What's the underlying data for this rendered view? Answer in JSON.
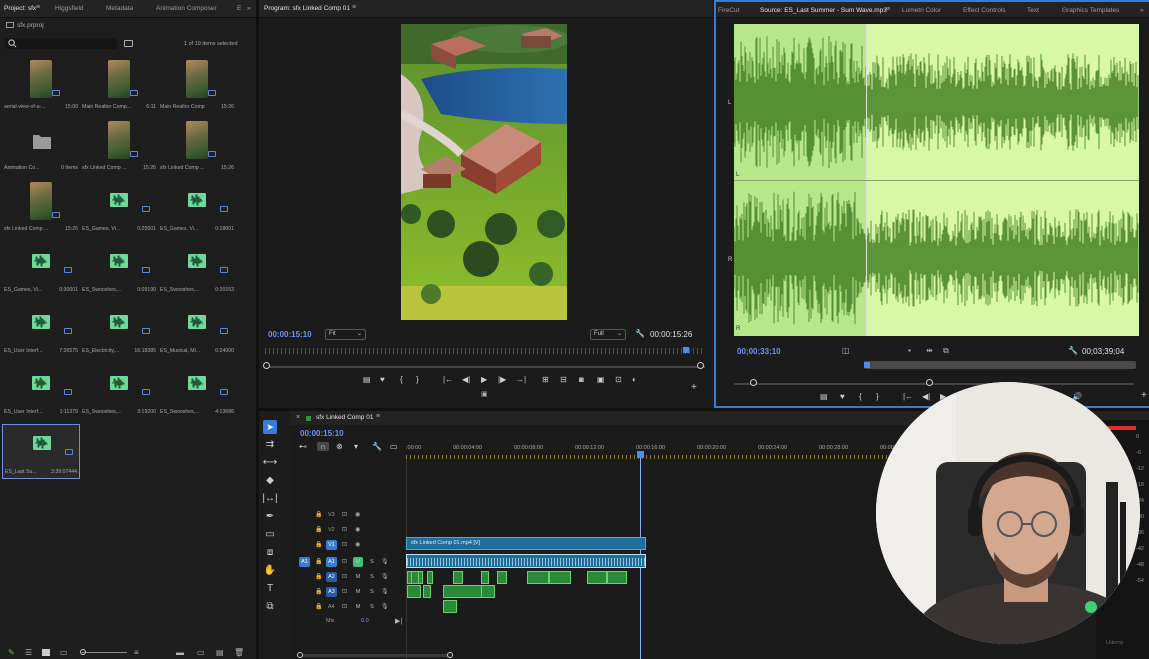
{
  "project_panel": {
    "tabs": [
      "Project: sfx",
      "Higgsfield",
      "Metadata",
      "Animation Composer",
      "E"
    ],
    "bin_name": "sfx.prproj",
    "selection_status": "1 of 19 items selected",
    "items": [
      {
        "name": "aerial-view-of-a-...",
        "duration": "15:00",
        "kind": "video"
      },
      {
        "name": "Main Realtor Comp...",
        "duration": "6:11",
        "kind": "video"
      },
      {
        "name": "Main Realtor Comp",
        "duration": "15:26",
        "kind": "video"
      },
      {
        "name": "Animation Co...",
        "duration": "0 Items",
        "kind": "folder"
      },
      {
        "name": "sfx Linked Comp ...",
        "duration": "15:26",
        "kind": "video"
      },
      {
        "name": "sfx Linked Comp ...",
        "duration": "15:26",
        "kind": "video"
      },
      {
        "name": "sfx Linked Comp ...",
        "duration": "15:26",
        "kind": "video"
      },
      {
        "name": "ES_Games, Vi...",
        "duration": "0:25501",
        "kind": "audio"
      },
      {
        "name": "ES_Games, Vi...",
        "duration": "0:18001",
        "kind": "audio"
      },
      {
        "name": "ES_Games, Vi...",
        "duration": "0:30001",
        "kind": "audio"
      },
      {
        "name": "ES_Swooshes,...",
        "duration": "0:09190",
        "kind": "audio"
      },
      {
        "name": "ES_Swooshes,...",
        "duration": "0:20153",
        "kind": "audio"
      },
      {
        "name": "ES_User Interf...",
        "duration": "7:36575",
        "kind": "audio"
      },
      {
        "name": "ES_Electricity,...",
        "duration": "16:18385",
        "kind": "audio"
      },
      {
        "name": "ES_Musical, Mi...",
        "duration": "0:24000",
        "kind": "audio"
      },
      {
        "name": "ES_User Interf...",
        "duration": "1:11379",
        "kind": "audio"
      },
      {
        "name": "ES_Swooshes,...",
        "duration": "3:19200",
        "kind": "audio"
      },
      {
        "name": "ES_Swooshes,...",
        "duration": "4:13686",
        "kind": "audio"
      },
      {
        "name": "ES_Last Su...",
        "duration": "3:39:07444",
        "kind": "audio",
        "selected": true
      }
    ]
  },
  "program_monitor": {
    "title": "Program: sfx Linked Comp 01",
    "timecode": "00:00:15:10",
    "fit": "Fit",
    "quality": "Full",
    "duration": "00:00:15:26"
  },
  "source_monitor": {
    "tabs": [
      "FireCut",
      "Source: ES_Last Summer - Sum Wave.mp3",
      "Lumetri Color",
      "Effect Controls",
      "Text",
      "Graphics Templates"
    ],
    "timecode": "00;00;33;10",
    "duration": "00;03;39;04",
    "channel_labels": [
      "L",
      "L",
      "R",
      "R"
    ]
  },
  "timeline": {
    "sequence_name": "sfx Linked Comp 01",
    "timecode": "00:00:15:10",
    "ruler": [
      ":00:00",
      "00:00:04:00",
      "00:00:08:00",
      "00:00:12:00",
      "00:00:16:00",
      "00:00:20:00",
      "00:00:24:00",
      "00:00:28:00",
      "00:00:32:00"
    ],
    "video_tracks": [
      "V3",
      "V2",
      "V1"
    ],
    "audio_tracks": [
      "A1",
      "A2",
      "A3",
      "A4"
    ],
    "mix_label": "Mix",
    "mix_value": "0.0",
    "video_clip": "sfx Linked Comp 01.mp4 [V]",
    "meter_ticks": [
      "0",
      "-6",
      "-12",
      "-18",
      "-24",
      "-30",
      "-36",
      "-42",
      "-48",
      "-54"
    ],
    "watermark": "Udemy"
  },
  "colors": {
    "accent_blue": "#3a7bd5",
    "timecode_blue": "#6d93f1",
    "waveform_bg": "#d8f7a7",
    "waveform_selected": "#b6e88a",
    "waveform_dark": "#3e7a1f",
    "clip_blue": "#1f6d9a",
    "audio_clip_green": "#2b8a3a"
  }
}
